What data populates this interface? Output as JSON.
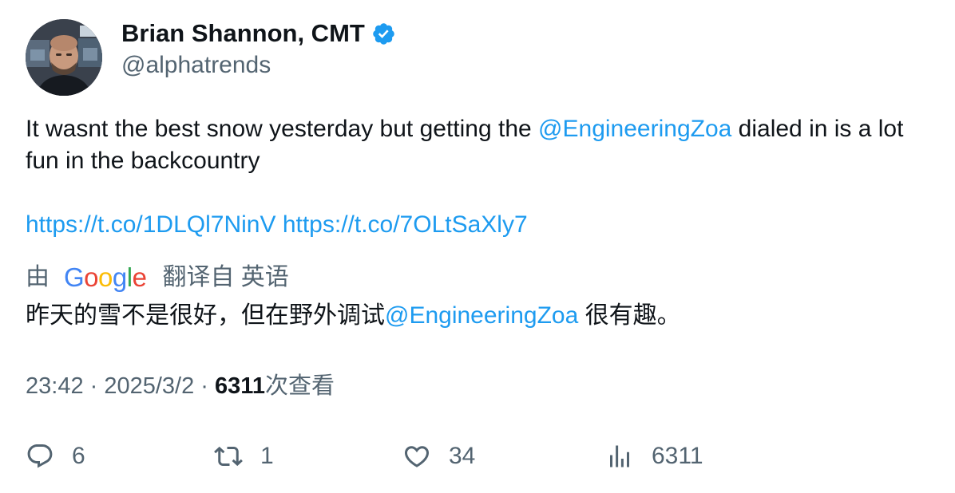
{
  "author": {
    "display_name": "Brian Shannon, CMT",
    "handle": "@alphatrends",
    "verified_badge_icon": "verified-check-icon",
    "badge_color": "#1d9bf0"
  },
  "tweet": {
    "text_before_mention": "It wasnt the best snow yesterday but getting the ",
    "mention": "@EngineeringZoa",
    "text_after_mention": " dialed in is a lot fun in the backcountry",
    "link1": "https://t.co/1DLQl7NinV",
    "link2": "https://t.co/7OLtSaXly7"
  },
  "translation": {
    "prefix": "由",
    "provider_logo_text": "Google",
    "suffix": "翻译自 英语",
    "text_before_mention": "昨天的雪不是很好，但在野外调试",
    "mention": "@EngineeringZoa",
    "text_after_mention": " 很有趣。"
  },
  "meta": {
    "time": "23:42",
    "separator": " · ",
    "date": "2025/3/2",
    "views_count": "6311",
    "views_label": "次查看"
  },
  "actions": {
    "reply_count": "6",
    "retweet_count": "1",
    "like_count": "34",
    "views_count": "6311"
  },
  "colors": {
    "link": "#1d9bf0",
    "secondary_text": "#536471",
    "primary_text": "#0f1419"
  }
}
